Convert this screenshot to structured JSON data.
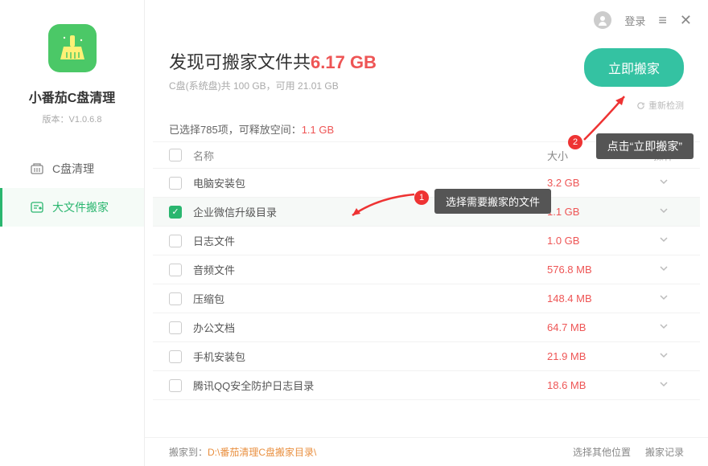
{
  "sidebar": {
    "app_name": "小番茄C盘清理",
    "version": "版本：V1.0.6.8",
    "nav": [
      {
        "label": "C盘清理",
        "icon": "disk-clean-icon"
      },
      {
        "label": "大文件搬家",
        "icon": "move-file-icon"
      }
    ],
    "active_index": 1
  },
  "titlebar": {
    "login_label": "登录"
  },
  "header": {
    "prefix": "发现可搬家文件共",
    "size": "6.17 GB",
    "sub": "C盘(系统盘)共 100 GB，可用 21.01 GB",
    "primary_button": "立即搬家",
    "rescan": "重新检测"
  },
  "status": {
    "prefix": "已选择785项，可释放空间：",
    "value": "1.1 GB"
  },
  "table": {
    "headers": {
      "name": "名称",
      "size": "大小",
      "op": "操作"
    },
    "rows": [
      {
        "name": "电脑安装包",
        "size": "3.2 GB",
        "checked": false
      },
      {
        "name": "企业微信升级目录",
        "size": "1.1 GB",
        "checked": true
      },
      {
        "name": "日志文件",
        "size": "1.0 GB",
        "checked": false
      },
      {
        "name": "音频文件",
        "size": "576.8 MB",
        "checked": false
      },
      {
        "name": "压缩包",
        "size": "148.4 MB",
        "checked": false
      },
      {
        "name": "办公文档",
        "size": "64.7 MB",
        "checked": false
      },
      {
        "name": "手机安装包",
        "size": "21.9 MB",
        "checked": false
      },
      {
        "name": "腾讯QQ安全防护日志目录",
        "size": "18.6 MB",
        "checked": false
      }
    ]
  },
  "footer": {
    "dest_label": "搬家到：",
    "dest_path": "D:\\番茄清理C盘搬家目录\\",
    "choose_other": "选择其他位置",
    "history": "搬家记录"
  },
  "annotations": {
    "step1_text": "选择需要搬家的文件",
    "step1_num": "1",
    "step2_text": "点击“立即搬家”",
    "step2_num": "2"
  }
}
